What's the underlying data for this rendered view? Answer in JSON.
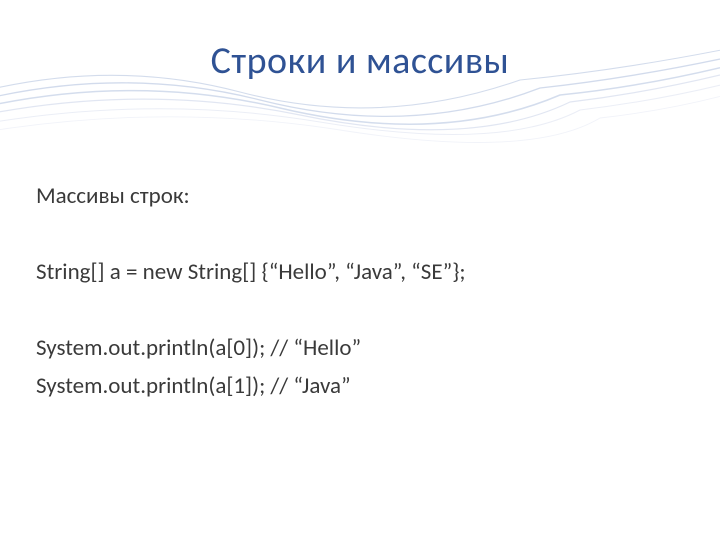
{
  "title": "Строки и массивы",
  "lines": {
    "l1": "Массивы строк:",
    "l2": "String[] a = new String[] {“Hello”, “Java”, “SE”};",
    "l3": "System.out.println(a[0]); // “Hello”",
    "l4": "System.out.println(a[1]); // “Java”"
  }
}
